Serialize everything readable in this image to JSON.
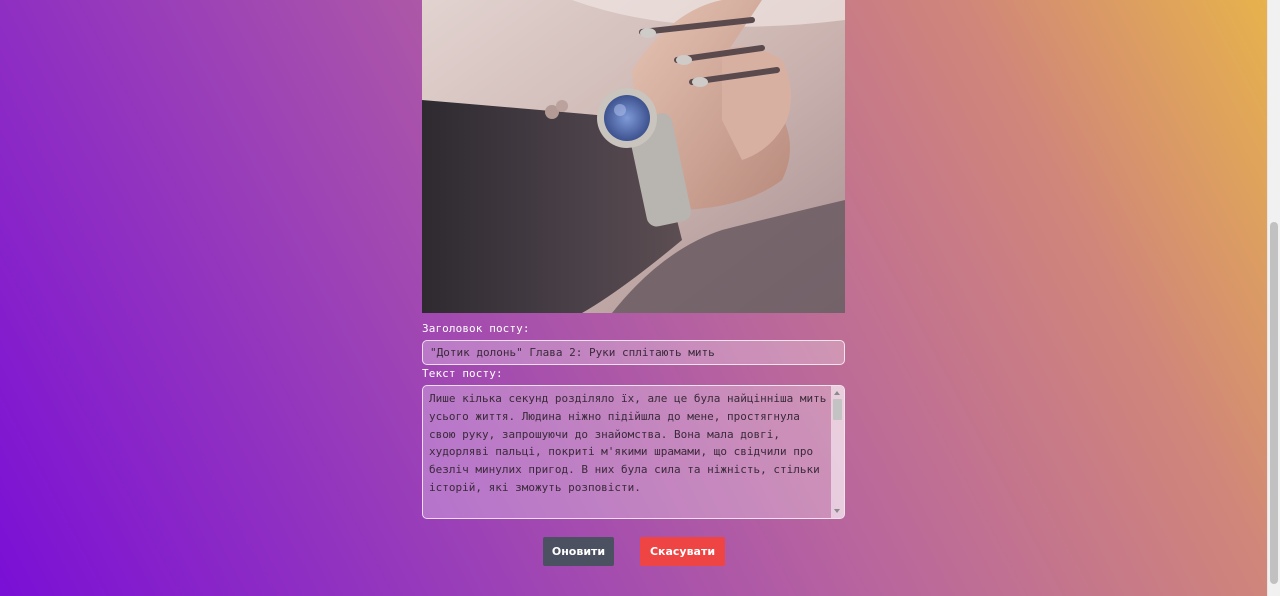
{
  "post_form": {
    "title_label": "Заголовок посту:",
    "title_value": "\"Дотик долонь\" Глава 2: Руки сплітають мить",
    "text_label": "Текст посту:",
    "text_value": "Лише кілька секунд розділяло їх, але це була найцінніша мить усього життя. Людина ніжно підійшла до мене, простягнула свою руку, запрошуючи до знайомства. Вона мала довгі, худорляві пальці, покриті м'якими шрамами, що свідчили про безліч минулих пригод. В них була сила та ніжність, стільки історій, які зможуть розповісти.\n\nЯ витягнув свою руку, зустрівшись з її долонею. Цей простий"
  },
  "actions": {
    "update_label": "Оновити",
    "cancel_label": "Скасувати"
  },
  "colors": {
    "update_button": "#4b5160",
    "cancel_button": "#ef4444"
  }
}
